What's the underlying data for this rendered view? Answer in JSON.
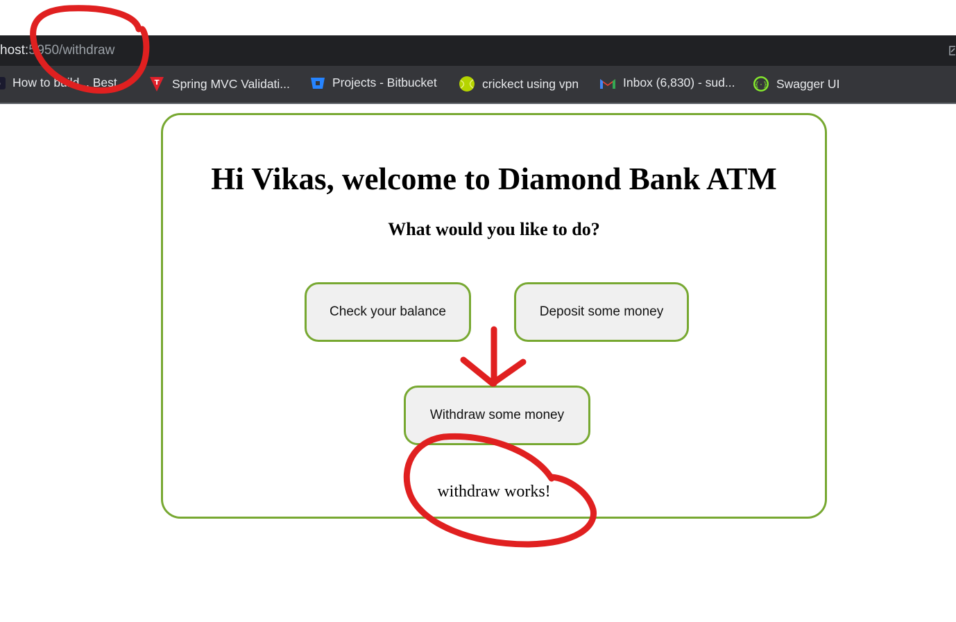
{
  "browser": {
    "url_host": "host:",
    "url_rest": "5 950/withdraw",
    "bookmarks": [
      {
        "label": "How to build... Best",
        "icon": "site-icon"
      },
      {
        "label": "Spring MVC Validati...",
        "icon": "red-t-icon"
      },
      {
        "label": "Projects - Bitbucket",
        "icon": "bitbucket-icon"
      },
      {
        "label": "crickect using vpn",
        "icon": "tennis-ball-icon"
      },
      {
        "label": "Inbox (6,830) - sud...",
        "icon": "gmail-icon"
      },
      {
        "label": "Swagger UI",
        "icon": "swagger-icon"
      }
    ]
  },
  "page": {
    "title": "Hi Vikas, welcome to Diamond Bank ATM",
    "subtitle": "What would you like to do?",
    "buttons": {
      "balance": "Check your balance",
      "deposit": "Deposit some money",
      "withdraw": "Withdraw some money"
    },
    "result": "withdraw works!"
  },
  "colors": {
    "accent": "#77a831",
    "annotation": "#e02020",
    "toolbar": "#202124",
    "bookmarks_bar": "#35363a"
  }
}
